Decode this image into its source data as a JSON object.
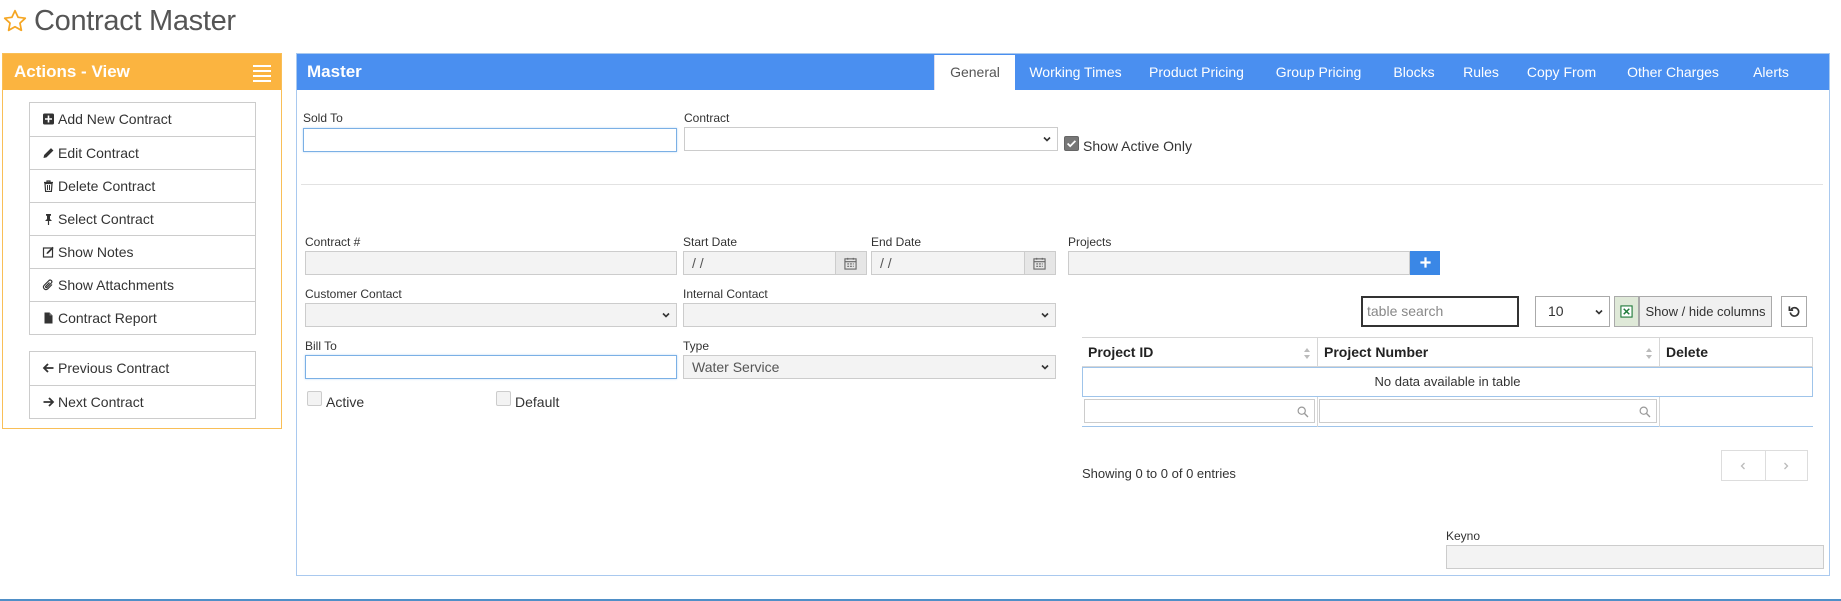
{
  "page": {
    "title": "Contract Master"
  },
  "actions": {
    "header": "Actions - View",
    "group1": [
      {
        "icon": "plus-square-icon",
        "label": "Add New Contract"
      },
      {
        "icon": "pencil-icon",
        "label": "Edit Contract"
      },
      {
        "icon": "trash-icon",
        "label": "Delete Contract"
      },
      {
        "icon": "pin-icon",
        "label": "Select Contract"
      },
      {
        "icon": "note-icon",
        "label": "Show Notes"
      },
      {
        "icon": "paperclip-icon",
        "label": "Show Attachments"
      },
      {
        "icon": "file-icon",
        "label": "Contract Report"
      }
    ],
    "group2": [
      {
        "icon": "arrow-left-icon",
        "label": "Previous Contract"
      },
      {
        "icon": "arrow-right-icon",
        "label": "Next Contract"
      }
    ]
  },
  "master": {
    "title": "Master",
    "tabs": [
      "General",
      "Working Times",
      "Product Pricing",
      "Group Pricing",
      "Blocks",
      "Rules",
      "Copy From",
      "Other Charges",
      "Alerts"
    ],
    "active_tab": "General"
  },
  "form": {
    "sold_to": {
      "label": "Sold To",
      "value": ""
    },
    "contract": {
      "label": "Contract",
      "value": ""
    },
    "show_active_only": {
      "label": "Show Active Only",
      "checked": true
    },
    "contract_no": {
      "label": "Contract #",
      "value": ""
    },
    "start_date": {
      "label": "Start Date",
      "value": " /  /"
    },
    "end_date": {
      "label": "End Date",
      "value": " /  /"
    },
    "projects": {
      "label": "Projects",
      "value": ""
    },
    "customer_contact": {
      "label": "Customer Contact",
      "value": ""
    },
    "internal_contact": {
      "label": "Internal Contact",
      "value": ""
    },
    "bill_to": {
      "label": "Bill To",
      "value": ""
    },
    "type": {
      "label": "Type",
      "value": "Water Service"
    },
    "active": {
      "label": "Active",
      "checked": false
    },
    "default": {
      "label": "Default",
      "checked": false
    },
    "keyno": {
      "label": "Keyno",
      "value": ""
    }
  },
  "projects_table": {
    "search_placeholder": "table search",
    "page_length": "10",
    "show_hide_label": "Show / hide columns",
    "columns": [
      "Project ID",
      "Project Number",
      "Delete"
    ],
    "empty_message": "No data available in table",
    "info": "Showing 0 to 0 of 0 entries"
  },
  "colors": {
    "actions_header": "#fbb440",
    "master_bar": "#4a8ff0",
    "plus_button": "#3a87e6"
  }
}
